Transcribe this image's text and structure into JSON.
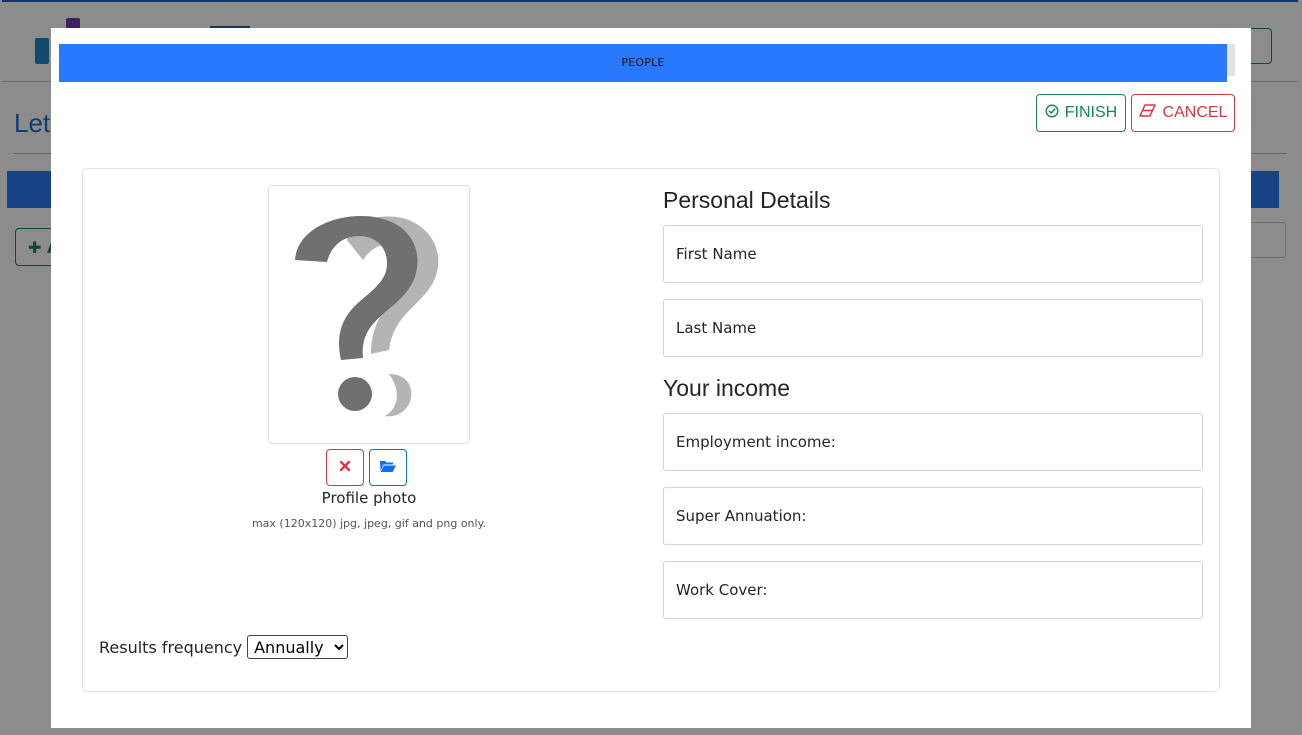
{
  "background": {
    "heading_fragment": "Let",
    "add_button_fragment": "A"
  },
  "modal": {
    "title": "PEOPLE",
    "finish_label": "FINISH",
    "cancel_label": "CANCEL"
  },
  "photo": {
    "label": "Profile photo",
    "hint": "max (120x120) jpg, jpeg, gif and png only.",
    "placeholder_icon": "question-mark-icon",
    "remove_icon": "times-icon",
    "browse_icon": "folder-open-icon"
  },
  "frequency": {
    "label": "Results frequency",
    "selected": "Annually"
  },
  "personal": {
    "title": "Personal Details",
    "first_name_label": "First Name",
    "last_name_label": "Last Name"
  },
  "income": {
    "title": "Your income",
    "employment_label": "Employment income:",
    "super_label": "Super Annuation:",
    "workcover_label": "Work Cover:"
  },
  "colors": {
    "accent_blue": "#2979ff",
    "success": "#198754",
    "danger": "#dc3545"
  }
}
